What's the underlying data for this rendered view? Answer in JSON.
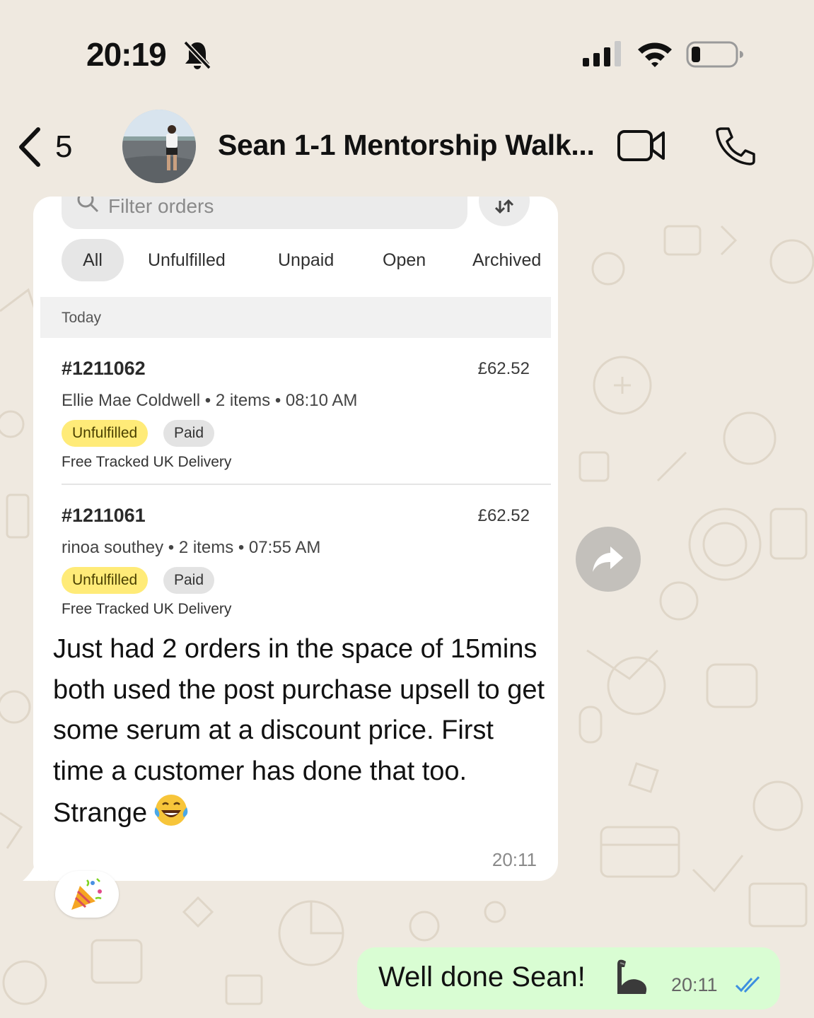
{
  "status_bar": {
    "time": "20:19",
    "icons": [
      "bell-slash-icon",
      "signal-icon",
      "wifi-icon",
      "battery-icon"
    ]
  },
  "header": {
    "back_count": "5",
    "title": "Sean 1-1 Mentorship Walk...",
    "icons": [
      "chevron-left-icon",
      "video-call-icon",
      "phone-icon"
    ]
  },
  "incoming_message": {
    "screenshot": {
      "filter_placeholder": "Filter orders",
      "tabs": [
        "All",
        "Unfulfilled",
        "Unpaid",
        "Open",
        "Archived"
      ],
      "active_tab": "All",
      "section": "Today",
      "orders": [
        {
          "id": "#1211062",
          "price": "£62.52",
          "meta": "Ellie Mae Coldwell • 2 items • 08:10 AM",
          "fulfillment": "Unfulfilled",
          "payment": "Paid",
          "delivery": "Free Tracked UK Delivery"
        },
        {
          "id": "#1211061",
          "price": "£62.52",
          "meta": "rinoa southey • 2 items • 07:55 AM",
          "fulfillment": "Unfulfilled",
          "payment": "Paid",
          "delivery": "Free Tracked UK Delivery"
        }
      ]
    },
    "text": "Just had 2 orders in the space of 15mins both used the post purchase upsell to get some serum at a discount price. First time a customer has done that too. Strange",
    "time": "20:11",
    "reaction_icon": "party-popper-icon"
  },
  "outgoing_message": {
    "text": "Well done Sean!",
    "emoji_icon": "flexed-biceps-icon",
    "time": "20:11",
    "status_icon": "double-check-read-icon"
  },
  "colors": {
    "wallpaper": "#efe9e0",
    "incoming_bubble": "#ffffff",
    "outgoing_bubble": "#d9fdd3",
    "read_ticks": "#3d8fe0",
    "unfulfilled_badge": "#ffeb78"
  }
}
